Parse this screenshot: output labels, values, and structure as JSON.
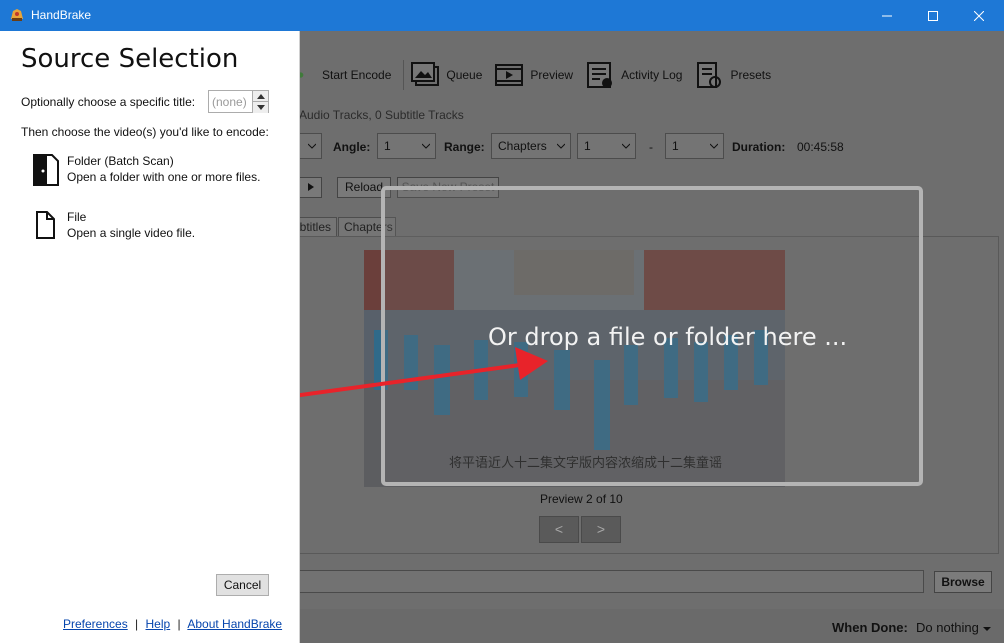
{
  "window": {
    "title": "HandBrake"
  },
  "toolbar": {
    "items": [
      {
        "label": "Start Encode",
        "icon": "play-icon"
      },
      {
        "label": "Queue",
        "icon": "queue-icon"
      },
      {
        "label": "Preview",
        "icon": "preview-icon"
      },
      {
        "label": "Activity Log",
        "icon": "activity-log-icon"
      },
      {
        "label": "Presets",
        "icon": "presets-icon"
      }
    ]
  },
  "source_info": "Audio Tracks, 0 Subtitle Tracks",
  "options": {
    "angle_label": "Angle:",
    "angle_value": "1",
    "range_label": "Range:",
    "range_value": "Chapters",
    "range_start": "1",
    "range_dash": "-",
    "range_end": "1",
    "duration_label": "Duration:",
    "duration_value": "00:45:58"
  },
  "preset_buttons": {
    "reload": "Reload",
    "save_new": "Save New Preset"
  },
  "tabs": [
    "Subtitles",
    "Chapters"
  ],
  "preview": {
    "subtitle_text": "将平语近人十二集文字版内容浓缩成十二集童谣",
    "caption": "Preview 2 of 10",
    "prev": "<",
    "next": ">"
  },
  "drop_zone": {
    "text": "Or drop a file or folder here ..."
  },
  "destination": {
    "browse": "Browse"
  },
  "status": {
    "when_done_label": "When Done:",
    "when_done_value": "Do nothing"
  },
  "source_selection": {
    "heading": "Source Selection",
    "title_label": "Optionally choose a specific title:",
    "title_value": "(none)",
    "choose_label": "Then choose the video(s) you'd like to encode:",
    "folder": {
      "title": "Folder (Batch Scan)",
      "desc": "Open a folder with one or more files."
    },
    "file": {
      "title": "File",
      "desc": "Open a single video file."
    },
    "cancel": "Cancel",
    "links": {
      "preferences": "Preferences",
      "help": "Help",
      "about": "About HandBrake",
      "sep": "|"
    }
  },
  "colors": {
    "titlebar": "#1e78d6",
    "arrow": "#e8232a",
    "link": "#0645ad"
  }
}
